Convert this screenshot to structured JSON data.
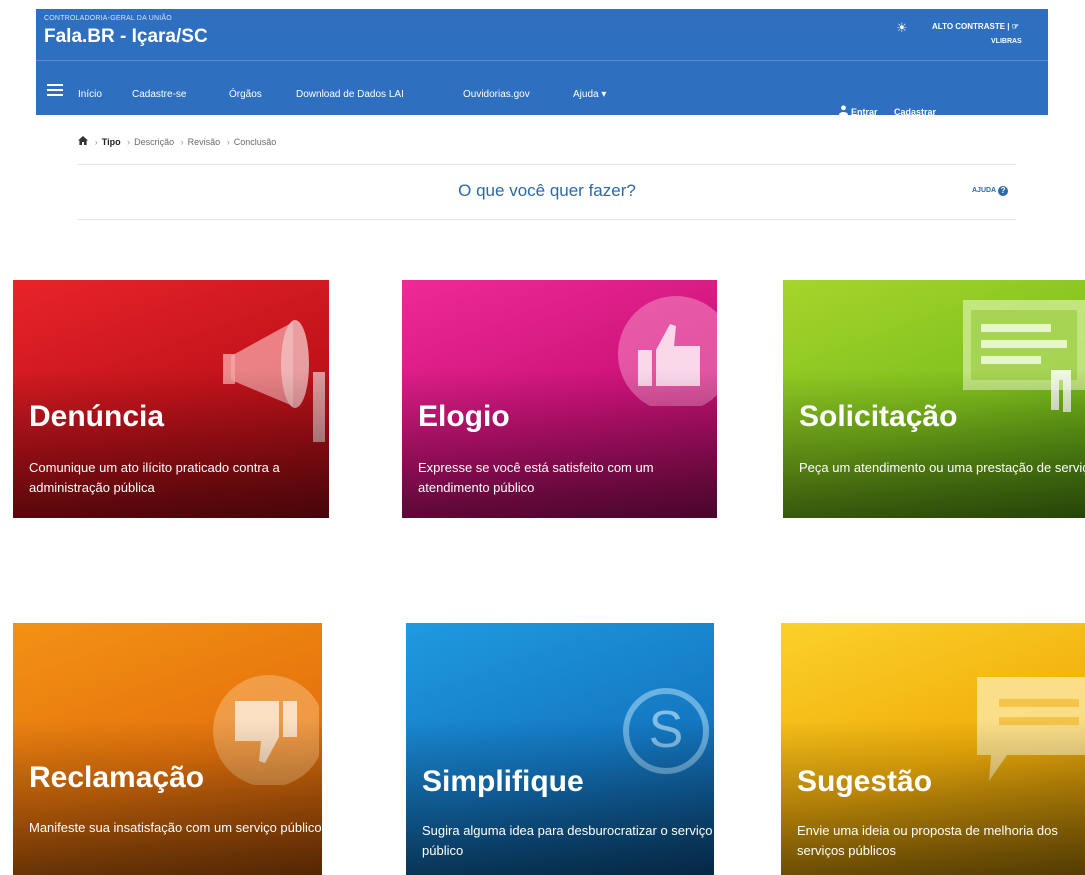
{
  "header": {
    "org": "CONTROLADORIA-GERAL DA UNIÃO",
    "title": "Fala.BR - Içara/SC",
    "contrast": "ALTO CONTRASTE | ☞",
    "vlibras": "VLIBRAS",
    "nav": [
      "Início",
      "Cadastre-se",
      "Órgãos",
      "Download de Dados LAI",
      "Ouvidorias.gov",
      "Ajuda ▾"
    ],
    "login": "Entrar",
    "register": "Cadastrar"
  },
  "breadcrumb": [
    "Tipo",
    "Descrição",
    "Revisão",
    "Conclusão"
  ],
  "page": {
    "title": "O que você quer fazer?",
    "help": "AJUDA"
  },
  "cards": [
    {
      "title": "Denúncia",
      "description": "Comunique um ato ilícito praticado contra a administração pública",
      "color": "#d0161a",
      "icon": "megaphone-icon"
    },
    {
      "title": "Elogio",
      "description": "Expresse se você está satisfeito com um atendimento público",
      "color": "#d81a82",
      "icon": "thumbs-up-icon"
    },
    {
      "title": "Solicitação",
      "description": "Peça um atendimento ou uma prestação de serviço",
      "color": "#7cbf1e",
      "icon": "computer-screen-icon"
    },
    {
      "title": "Reclamação",
      "description": "Manifeste sua insatisfação com um serviço público",
      "color": "#e87a0c",
      "icon": "thumbs-down-icon"
    },
    {
      "title": "Simplifique",
      "description": "Sugira alguma idea para desburocratizar o serviço público",
      "color": "#1685cc",
      "icon": "simplifique-s-icon"
    },
    {
      "title": "Sugestão",
      "description": "Envie uma ideia ou proposta de melhoria dos serviços públicos",
      "color": "#f3b30a",
      "icon": "speech-bubble-icon"
    }
  ]
}
